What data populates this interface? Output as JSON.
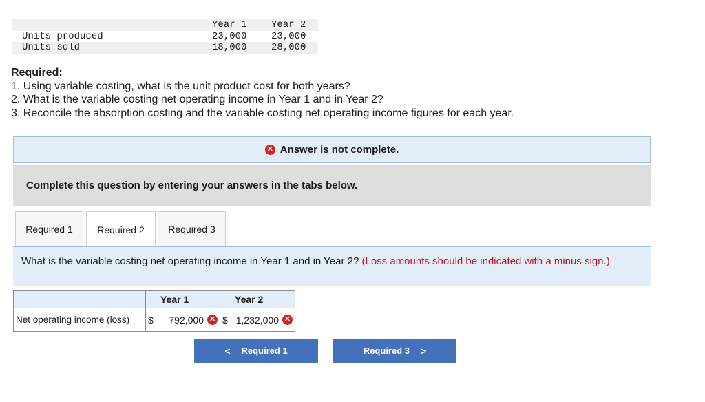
{
  "units_table": {
    "headers": [
      "Year 1",
      "Year 2"
    ],
    "rows": [
      {
        "label": "Units produced",
        "year1": "23,000",
        "year2": "23,000"
      },
      {
        "label": "Units sold",
        "year1": "18,000",
        "year2": "28,000"
      }
    ]
  },
  "required": {
    "title": "Required:",
    "items": [
      "1. Using variable costing, what is the unit product cost for both years?",
      "2. What is the variable costing net operating income in Year 1 and in Year 2?",
      "3. Reconcile the absorption costing and the variable costing net operating income figures for each year."
    ]
  },
  "banner": {
    "text": "Answer is not complete.",
    "icon": "x-circle-icon",
    "icon_color": "#d42121"
  },
  "instruction": "Complete this question by entering your answers in the tabs below.",
  "tabs": [
    {
      "label": "Required 1",
      "active": false
    },
    {
      "label": "Required 2",
      "active": true
    },
    {
      "label": "Required 3",
      "active": false
    }
  ],
  "question": {
    "text": "What is the variable costing net operating income in Year 1 and in Year 2?",
    "note": "(Loss amounts should be indicated with a minus sign.)"
  },
  "answer_table": {
    "headers": [
      "Year 1",
      "Year 2"
    ],
    "row_label": "Net operating income (loss)",
    "currency": "$",
    "year1_value": "792,000",
    "year1_status": "incorrect",
    "year2_value": "1,232,000",
    "year2_status": "incorrect"
  },
  "nav": {
    "prev_label": "Required 1",
    "next_label": "Required 3",
    "button_color": "#4472ba"
  }
}
